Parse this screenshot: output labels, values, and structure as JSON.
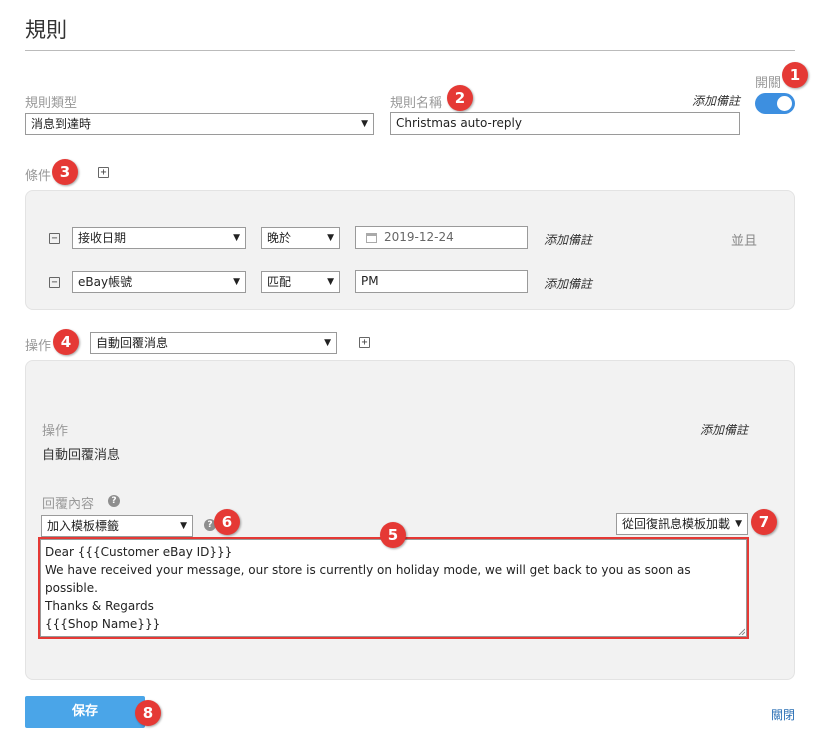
{
  "page": {
    "title": "規則"
  },
  "rule": {
    "type_label": "規則類型",
    "type_value": "消息到達時",
    "name_label": "規則名稱",
    "name_value": "Christmas auto-reply",
    "add_note": "添加備註",
    "switch_label": "開關",
    "switch_on": true
  },
  "conditions": {
    "label": "條件",
    "rows": [
      {
        "field": "接收日期",
        "operator": "晚於",
        "value": "2019-12-24",
        "note": "添加備註"
      },
      {
        "field": "eBay帳號",
        "operator": "匹配",
        "value": "PM",
        "note": "添加備註"
      }
    ],
    "and_label": "並且"
  },
  "action": {
    "label": "操作",
    "value": "自動回覆消息",
    "detail": {
      "heading": "操作",
      "name": "自動回覆消息",
      "note": "添加備註",
      "reply_label": "回覆內容",
      "insert_tag": "加入模板標籤",
      "load_template": "從回復訊息模板加載",
      "message_lines": [
        "Dear {{{Customer eBay ID}}}",
        "We have received your message, our store is currently on holiday mode, we will get back to you as soon as possible.",
        "Thanks & Regards",
        "{{{Shop Name}}}"
      ]
    }
  },
  "footer": {
    "save": "保存",
    "close": "關閉"
  },
  "badges": [
    "1",
    "2",
    "3",
    "4",
    "5",
    "6",
    "7",
    "8"
  ],
  "icons": {
    "caret": "▼",
    "add": "+",
    "remove": "−",
    "calendar": "calendar-icon",
    "help": "?"
  },
  "colors": {
    "accent": "#3d8fe0",
    "badge": "#e53935",
    "save": "#4aa5e8",
    "link": "#2a6fb5"
  }
}
